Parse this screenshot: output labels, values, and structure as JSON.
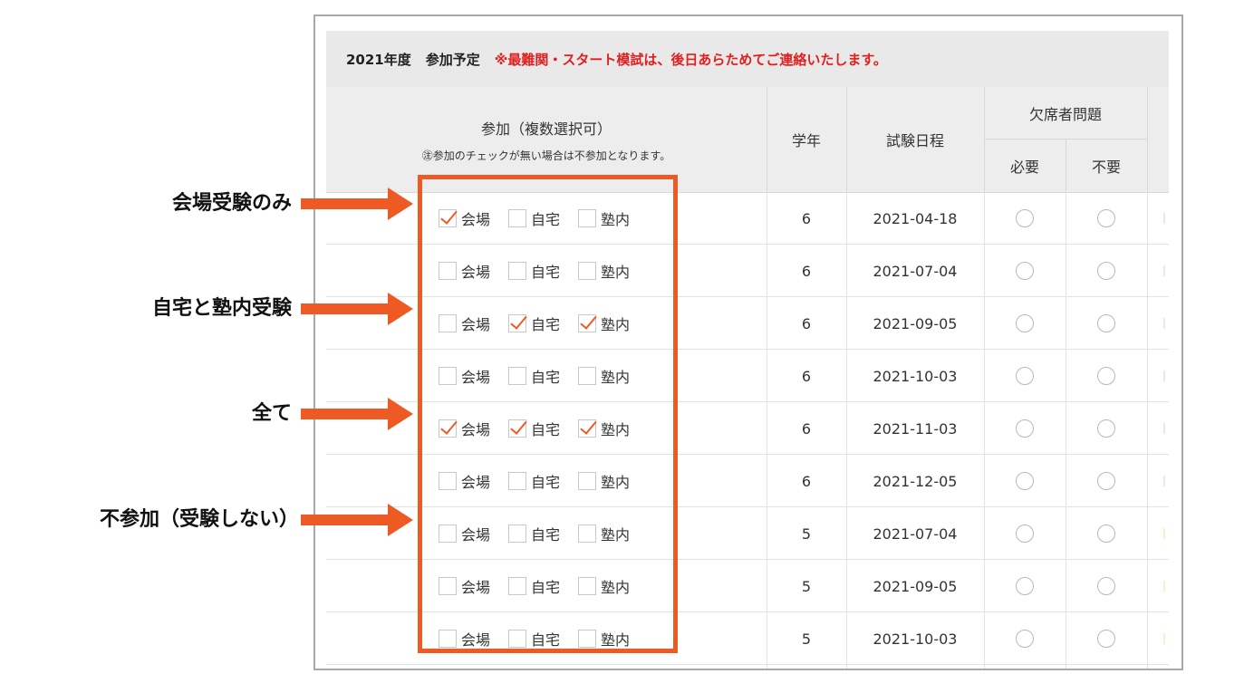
{
  "title": {
    "year": "2021年度",
    "schedule": "参加予定",
    "notice": "※最難関・スタート模試は、後日あらためてご連絡いたします。"
  },
  "headers": {
    "participation": "参加（複数選択可）",
    "participation_note": "㊟参加のチェックが無い場合は不参加となります。",
    "grade": "学年",
    "date": "試験日程",
    "absent": "欠席者問題",
    "needed": "必要",
    "not_needed": "不要"
  },
  "options": [
    "会場",
    "自宅",
    "塾内"
  ],
  "rows": [
    {
      "checked": [
        true,
        false,
        false
      ],
      "grade": "6",
      "date": "2021-04-18"
    },
    {
      "checked": [
        false,
        false,
        false
      ],
      "grade": "6",
      "date": "2021-07-04"
    },
    {
      "checked": [
        false,
        true,
        true
      ],
      "grade": "6",
      "date": "2021-09-05"
    },
    {
      "checked": [
        false,
        false,
        false
      ],
      "grade": "6",
      "date": "2021-10-03"
    },
    {
      "checked": [
        true,
        true,
        true
      ],
      "grade": "6",
      "date": "2021-11-03"
    },
    {
      "checked": [
        false,
        false,
        false
      ],
      "grade": "6",
      "date": "2021-12-05"
    },
    {
      "checked": [
        false,
        false,
        false
      ],
      "grade": "5",
      "date": "2021-07-04"
    },
    {
      "checked": [
        false,
        false,
        false
      ],
      "grade": "5",
      "date": "2021-09-05"
    },
    {
      "checked": [
        false,
        false,
        false
      ],
      "grade": "5",
      "date": "2021-10-03"
    }
  ],
  "annotations": [
    "会場受験のみ",
    "自宅と塾内受験",
    "全て",
    "不参加（受験しない）"
  ],
  "colors": {
    "accent": "#ee5a24",
    "notice": "#e02020",
    "header_bg": "#ededed"
  }
}
